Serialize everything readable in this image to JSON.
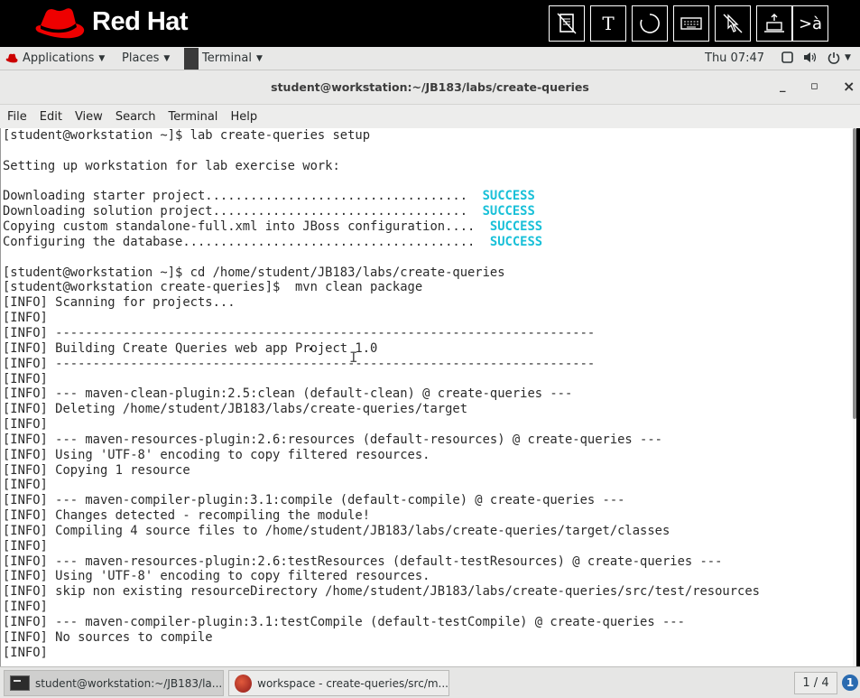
{
  "brand": {
    "name": "Red Hat"
  },
  "toolbar": {
    "buttons": [
      {
        "id": "document",
        "icon": "document-icon"
      },
      {
        "id": "text",
        "label": "T",
        "icon": "text-icon"
      },
      {
        "id": "circle",
        "icon": "circle-icon"
      },
      {
        "id": "keyboard",
        "icon": "keyboard-icon"
      },
      {
        "id": "no-pointer",
        "icon": "pointer-disabled-icon"
      },
      {
        "id": "upload",
        "icon": "upload-laptop-icon"
      },
      {
        "id": "input-method",
        "label": ">à",
        "icon": "input-method-icon"
      }
    ]
  },
  "panel": {
    "applications": "Applications",
    "places": "Places",
    "terminal": "Terminal",
    "clock": "Thu 07:47"
  },
  "window": {
    "title": "student@workstation:~/JB183/labs/create-queries",
    "minimize": "_",
    "maximize": "▫",
    "close": "×"
  },
  "menu": [
    "File",
    "Edit",
    "View",
    "Search",
    "Terminal",
    "Help"
  ],
  "terminal": {
    "lines": [
      {
        "text": "[student@workstation ~]$ lab create-queries setup"
      },
      {
        "text": ""
      },
      {
        "text": "Setting up workstation for lab exercise work:"
      },
      {
        "text": ""
      },
      {
        "text": "Downloading starter project...................................  ",
        "status": "SUCCESS"
      },
      {
        "text": "Downloading solution project..................................  ",
        "status": "SUCCESS"
      },
      {
        "text": "Copying custom standalone-full.xml into JBoss configuration....  ",
        "status": "SUCCESS"
      },
      {
        "text": "Configuring the database.......................................  ",
        "status": "SUCCESS"
      },
      {
        "text": ""
      },
      {
        "text": "[student@workstation ~]$ cd /home/student/JB183/labs/create-queries"
      },
      {
        "text": "[student@workstation create-queries]$  mvn clean package"
      },
      {
        "text": "[INFO] Scanning for projects..."
      },
      {
        "text": "[INFO]"
      },
      {
        "text": "[INFO] ------------------------------------------------------------------------"
      },
      {
        "text": "[INFO] Building Create Queries web app Project 1.0"
      },
      {
        "text": "[INFO] ------------------------------------------------------------------------"
      },
      {
        "text": "[INFO]"
      },
      {
        "text": "[INFO] --- maven-clean-plugin:2.5:clean (default-clean) @ create-queries ---"
      },
      {
        "text": "[INFO] Deleting /home/student/JB183/labs/create-queries/target"
      },
      {
        "text": "[INFO]"
      },
      {
        "text": "[INFO] --- maven-resources-plugin:2.6:resources (default-resources) @ create-queries ---"
      },
      {
        "text": "[INFO] Using 'UTF-8' encoding to copy filtered resources."
      },
      {
        "text": "[INFO] Copying 1 resource"
      },
      {
        "text": "[INFO]"
      },
      {
        "text": "[INFO] --- maven-compiler-plugin:3.1:compile (default-compile) @ create-queries ---"
      },
      {
        "text": "[INFO] Changes detected - recompiling the module!"
      },
      {
        "text": "[INFO] Compiling 4 source files to /home/student/JB183/labs/create-queries/target/classes"
      },
      {
        "text": "[INFO]"
      },
      {
        "text": "[INFO] --- maven-resources-plugin:2.6:testResources (default-testResources) @ create-queries ---"
      },
      {
        "text": "[INFO] Using 'UTF-8' encoding to copy filtered resources."
      },
      {
        "text": "[INFO] skip non existing resourceDirectory /home/student/JB183/labs/create-queries/src/test/resources"
      },
      {
        "text": "[INFO]"
      },
      {
        "text": "[INFO] --- maven-compiler-plugin:3.1:testCompile (default-testCompile) @ create-queries ---"
      },
      {
        "text": "[INFO] No sources to compile"
      },
      {
        "text": "[INFO]"
      }
    ]
  },
  "taskbar": {
    "tasks": [
      {
        "label": "student@workstation:~/JB183/la...",
        "icon": "terminal-icon"
      },
      {
        "label": "workspace - create-queries/src/m...",
        "icon": "eclipse-icon"
      }
    ],
    "pager": "1 / 4",
    "info": "1"
  },
  "colors": {
    "success": "#19c0d8",
    "brand_red": "#ee0000"
  }
}
